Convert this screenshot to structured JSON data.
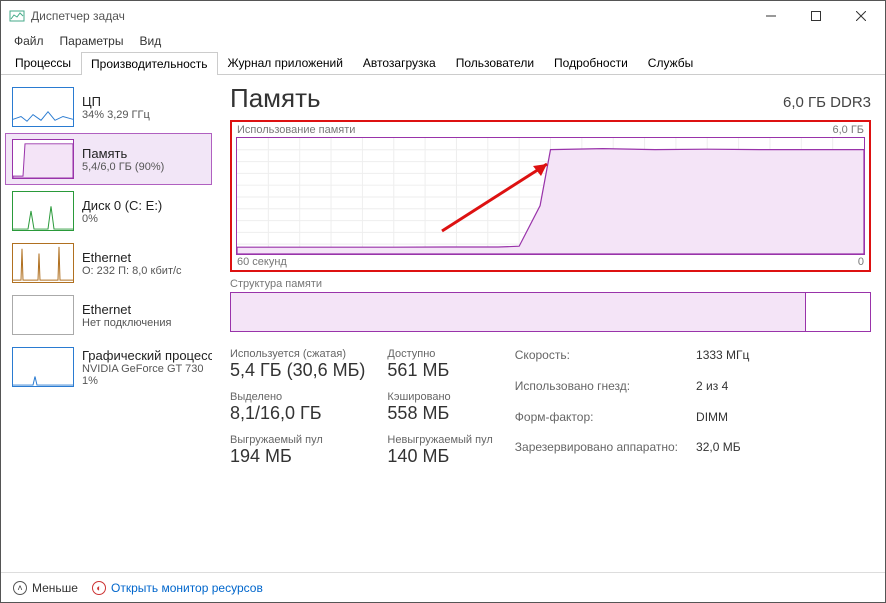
{
  "window": {
    "title": "Диспетчер задач"
  },
  "menu": [
    "Файл",
    "Параметры",
    "Вид"
  ],
  "tabs": [
    "Процессы",
    "Производительность",
    "Журнал приложений",
    "Автозагрузка",
    "Пользователи",
    "Подробности",
    "Службы"
  ],
  "active_tab": 1,
  "sidebar": [
    {
      "name": "ЦП",
      "sub": "34% 3,29 ГГц",
      "color": "#2a7bd1"
    },
    {
      "name": "Память",
      "sub": "5,4/6,0 ГБ (90%)",
      "color": "#9933aa",
      "selected": true
    },
    {
      "name": "Диск 0 (C: E:)",
      "sub": "0%",
      "color": "#2a9a3a"
    },
    {
      "name": "Ethernet",
      "sub": "О: 232  П: 8,0 кбит/с",
      "color": "#b07020"
    },
    {
      "name": "Ethernet",
      "sub": "Нет подключения",
      "color": "#888"
    },
    {
      "name": "Графический процессор",
      "sub": "NVIDIA GeForce GT 730",
      "sub2": "1%",
      "color": "#2a7bd1"
    }
  ],
  "header": {
    "title": "Память",
    "right": "6,0 ГБ DDR3"
  },
  "usage_chart": {
    "title": "Использование памяти",
    "max": "6,0 ГБ",
    "xaxis_left": "60 секунд",
    "xaxis_right": "0"
  },
  "chart_data": {
    "type": "area",
    "ylim": [
      0,
      6.0
    ],
    "x_seconds": [
      60,
      0
    ],
    "points": [
      {
        "t": 60,
        "gb": 0.35
      },
      {
        "t": 55,
        "gb": 0.35
      },
      {
        "t": 50,
        "gb": 0.35
      },
      {
        "t": 45,
        "gb": 0.35
      },
      {
        "t": 40,
        "gb": 0.36
      },
      {
        "t": 35,
        "gb": 0.36
      },
      {
        "t": 33,
        "gb": 0.4
      },
      {
        "t": 31,
        "gb": 2.5
      },
      {
        "t": 30,
        "gb": 5.4
      },
      {
        "t": 25,
        "gb": 5.45
      },
      {
        "t": 20,
        "gb": 5.4
      },
      {
        "t": 15,
        "gb": 5.42
      },
      {
        "t": 10,
        "gb": 5.4
      },
      {
        "t": 5,
        "gb": 5.4
      },
      {
        "t": 0,
        "gb": 5.4
      }
    ],
    "title": "Использование памяти",
    "ylabel": "ГБ"
  },
  "structure": {
    "label": "Структура памяти",
    "used_fraction": 0.9
  },
  "stats_left": [
    {
      "lbl": "Используется (сжатая)",
      "val": "5,4 ГБ (30,6 МБ)"
    },
    {
      "lbl": "Доступно",
      "val": "561 МБ"
    },
    {
      "lbl": "Выделено",
      "val": "8,1/16,0 ГБ"
    },
    {
      "lbl": "Кэшировано",
      "val": "558 МБ"
    },
    {
      "lbl": "Выгружаемый пул",
      "val": "194 МБ"
    },
    {
      "lbl": "Невыгружаемый пул",
      "val": "140 МБ"
    }
  ],
  "stats_right": [
    {
      "lbl": "Скорость:",
      "val": "1333 МГц"
    },
    {
      "lbl": "Использовано гнезд:",
      "val": "2 из 4"
    },
    {
      "lbl": "Форм-фактор:",
      "val": "DIMM"
    },
    {
      "lbl": "Зарезервировано аппаратно:",
      "val": "32,0 МБ"
    }
  ],
  "footer": {
    "less": "Меньше",
    "link": "Открыть монитор ресурсов"
  }
}
